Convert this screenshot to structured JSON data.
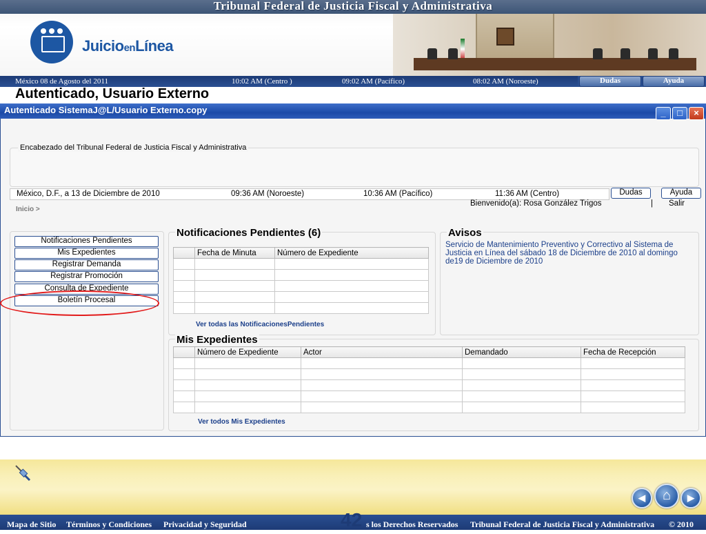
{
  "banner": {
    "title": "Tribunal Federal de Justicia Fiscal y Administrativa",
    "logo_text_1": "Juicio",
    "logo_text_2": "en",
    "logo_text_3": "Línea"
  },
  "timebar": {
    "date": "México 08 de Agosto del 2011",
    "time_centro": "10:02  AM (Centro )",
    "time_pacifico": "09:02 AM  (Pacífico)",
    "time_noroeste": "08:02 AM (Noroeste)",
    "dudas": "Dudas",
    "ayuda": "Ayuda"
  },
  "page_title": "Autenticado, Usuario Externo",
  "window": {
    "title": "Autenticado SistemaJ@L/Usuario Externo.copy",
    "minimize": "_",
    "maximize": "□",
    "close": "×"
  },
  "header": {
    "label": "Encabezado del Tribunal Federal de Justicia Fiscal y Administrativa",
    "date": "México, D.F., a 13 de Diciembre de 2010",
    "time_noroeste": "09:36 AM (Noroeste)",
    "time_pacifico": "10:36 AM (Pacífico)",
    "time_centro": "11:36 AM (Centro)",
    "dudas": "Dudas",
    "ayuda": "Ayuda",
    "breadcrumb": "Inicio >",
    "welcome": "Bienvenido(a): Rosa González Trigos",
    "separator": "|",
    "salir": "Salir"
  },
  "menu": {
    "items": [
      {
        "label": "Notificaciones Pendientes"
      },
      {
        "label": "Mis Expedientes"
      },
      {
        "label": "Registrar Demanda"
      },
      {
        "label": "Registrar Promoción"
      },
      {
        "label": "Consulta de Expediente"
      },
      {
        "label": "Boletín Procesal"
      }
    ]
  },
  "notificaciones": {
    "title": "Notificaciones Pendientes (6)",
    "columns": [
      "",
      "Fecha de Minuta",
      "Número de Expediente"
    ],
    "link": "Ver todas las NotificacionesPendientes"
  },
  "avisos": {
    "title": "Avisos",
    "text": "Servicio de Mantenimiento Preventivo y Correctivo al Sistema de Justicia en Línea del sábado 18 de Diciembre de 2010 al domingo de19 de Diciembre de 2010"
  },
  "expedientes": {
    "title": "Mis Expedientes",
    "columns": [
      "",
      "Número de Expediente",
      "Actor",
      "Demandado",
      "Fecha de Recepción"
    ],
    "link": "Ver todos Mis Expedientes"
  },
  "footer": {
    "mapa": "Mapa de Sitio",
    "terminos": "Términos y Condiciones",
    "privacidad": "Privacidad y Seguridad",
    "page_number": "42",
    "derechos": "s los Derechos Reservados",
    "tribunal": "Tribunal Federal de Justicia Fiscal y Administrativa",
    "copyright": "© 2010",
    "prev_icon": "◀",
    "home_icon": "⌂",
    "next_icon": "▶"
  },
  "colors": {
    "accent_blue": "#1d3b76",
    "window_title_blue": "#1b4aa8",
    "highlight_red": "#e21a1a"
  }
}
